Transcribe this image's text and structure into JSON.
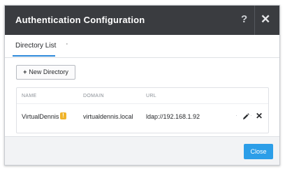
{
  "dialog": {
    "title": "Authentication Configuration",
    "help_glyph": "?",
    "close_glyph": "✕"
  },
  "tabs": [
    {
      "label": "Directory List",
      "active": true
    },
    {
      "label": "·"
    }
  ],
  "toolbar": {
    "new_directory_label": "New Directory",
    "plus_glyph": "+"
  },
  "table": {
    "headers": [
      "NAME",
      "DOMAIN",
      "URL"
    ],
    "rows": [
      {
        "name": "VirtualDennis",
        "warning_glyph": "!",
        "domain": "virtualdennis.local",
        "url": "ldap://192.168.1.92",
        "separator": "·"
      }
    ]
  },
  "footer": {
    "close_label": "Close"
  },
  "colors": {
    "accent": "#2c9ee8",
    "titlebar": "#3a3c40",
    "warning": "#f0b42a"
  }
}
